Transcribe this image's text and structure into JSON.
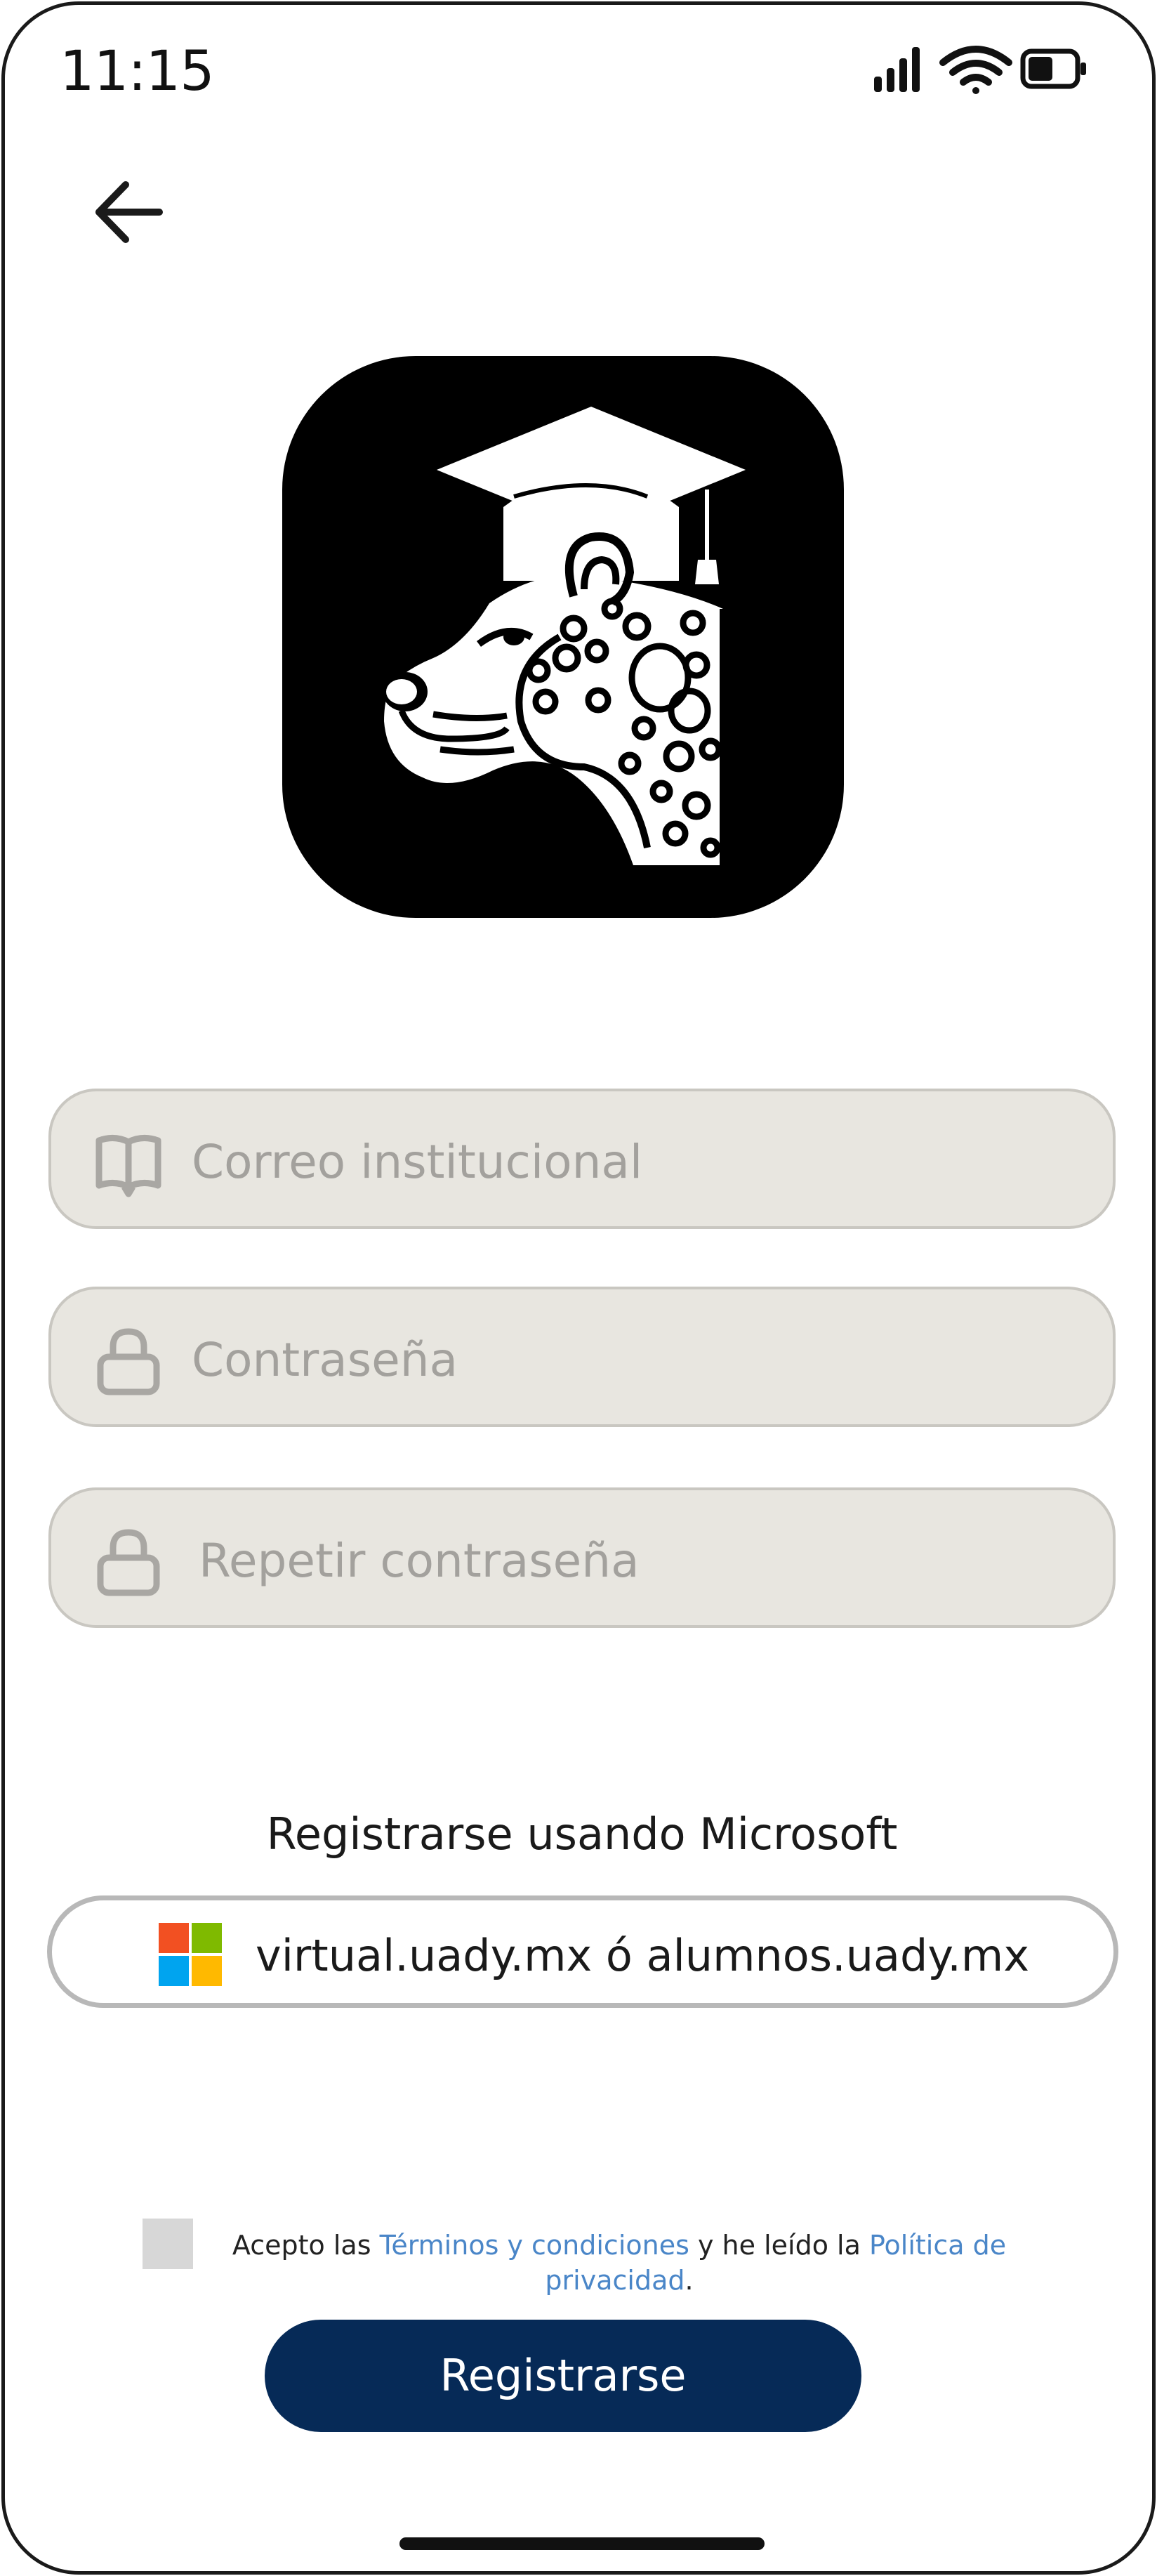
{
  "status_bar": {
    "time": "11:15",
    "icons": [
      "signal-icon",
      "wifi-icon",
      "battery-icon"
    ]
  },
  "nav": {
    "back_icon": "arrow-left-icon"
  },
  "logo": {
    "icon": "jaguar-graduation-cap-icon"
  },
  "form": {
    "email": {
      "placeholder": "Correo institucional",
      "value": "",
      "icon": "book-icon"
    },
    "password": {
      "placeholder": "Contraseña",
      "value": "",
      "icon": "lock-icon"
    },
    "repeat_password": {
      "placeholder": "Repetir contraseña",
      "value": "",
      "icon": "lock-icon"
    }
  },
  "microsoft": {
    "heading": "Registrarse usando Microsoft",
    "button_label": "virtual.uady.mx ó alumnos.uady.mx",
    "icon": "microsoft-logo-icon"
  },
  "terms": {
    "checked": false,
    "text_before": "Acepto las ",
    "terms_link": "Términos y condiciones",
    "text_middle": " y he leído la ",
    "privacy_link": "Política de privacidad",
    "text_after": "."
  },
  "register_button": {
    "label": "Registrarse"
  },
  "colors": {
    "field_bg": "#e8e6e0",
    "primary": "#062a57",
    "link": "#4a86c8",
    "ms_red": "#f25022",
    "ms_green": "#7fba00",
    "ms_blue": "#00a4ef",
    "ms_yellow": "#ffb900"
  }
}
